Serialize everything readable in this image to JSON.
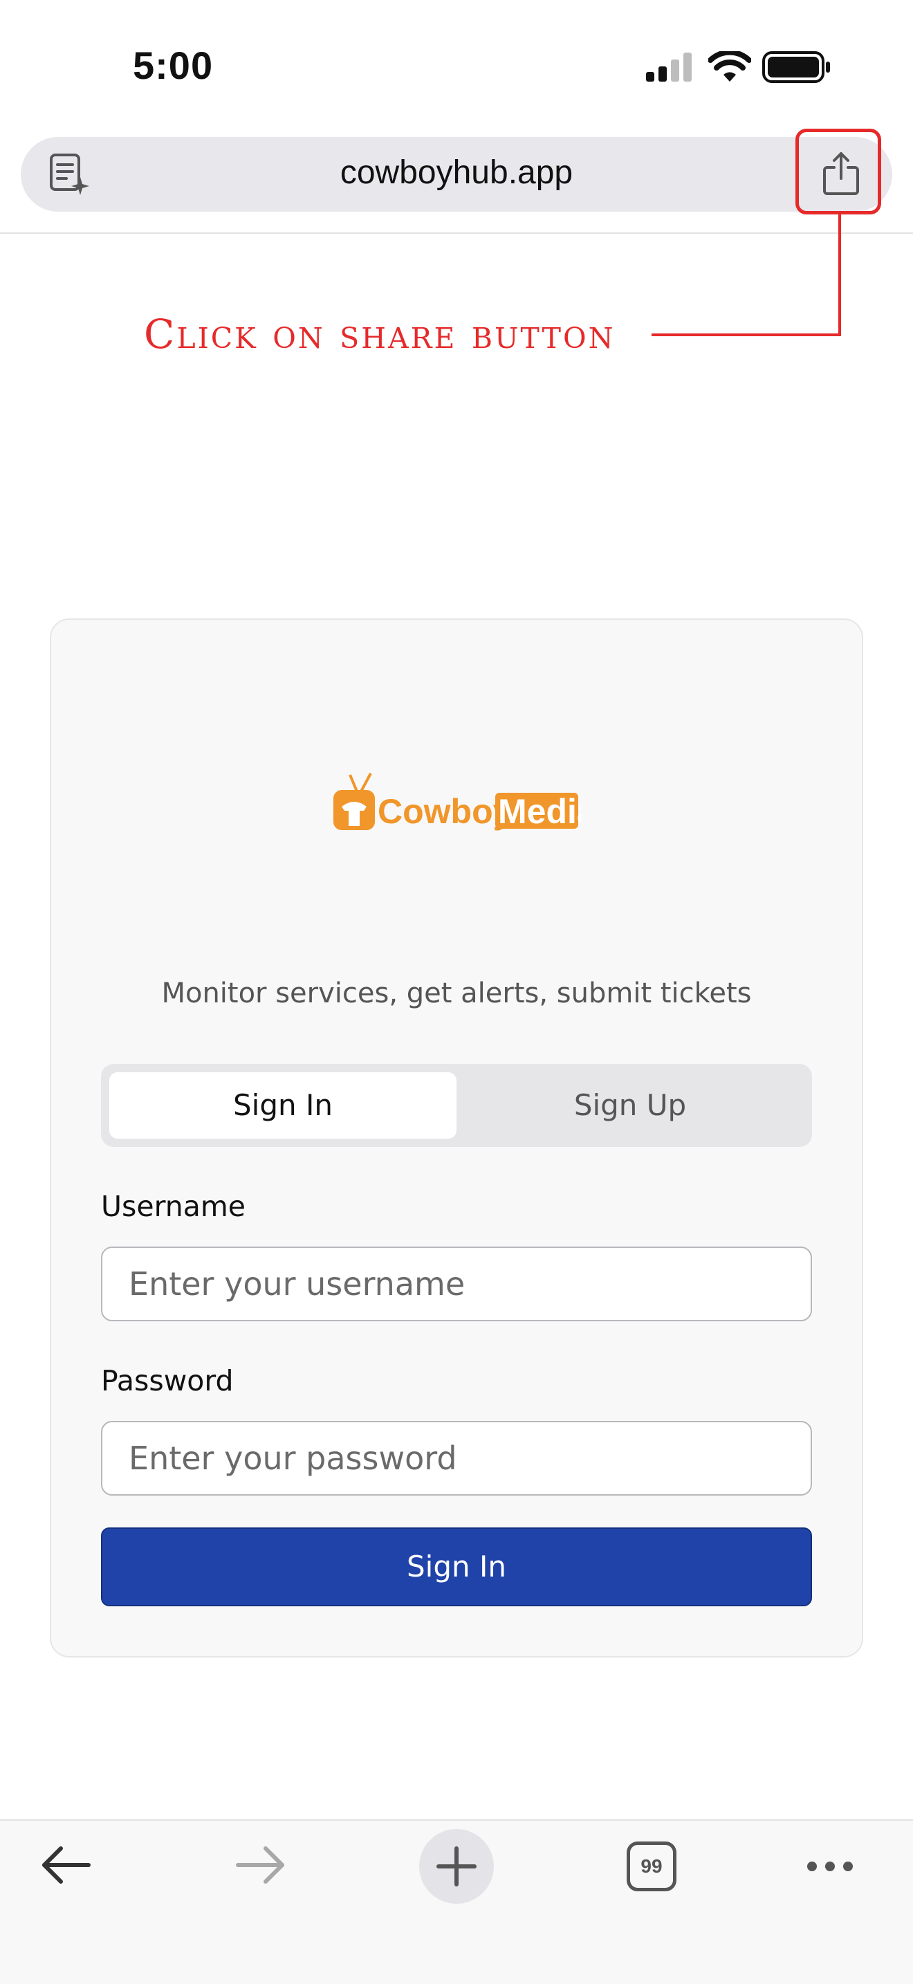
{
  "status_bar": {
    "time": "5:00"
  },
  "browser": {
    "url": "cowboyhub.app",
    "tabs_count": "99"
  },
  "annotation": {
    "text": "Click on share button",
    "color": "#e62a2a"
  },
  "login": {
    "logo_text_primary": "Cowboy",
    "logo_text_secondary": "Media",
    "tagline": "Monitor services, get alerts, submit tickets",
    "tabs": [
      {
        "label": "Sign In",
        "active": true
      },
      {
        "label": "Sign Up",
        "active": false
      }
    ],
    "username": {
      "label": "Username",
      "placeholder": "Enter your username",
      "value": ""
    },
    "password": {
      "label": "Password",
      "placeholder": "Enter your password",
      "value": ""
    },
    "submit_label": "Sign In",
    "accent_color": "#1f43a8",
    "logo_color": "#f0962a"
  },
  "icons": {
    "reader": "reader-mode-icon",
    "share": "share-icon",
    "back": "back-arrow-icon",
    "forward": "forward-arrow-icon",
    "new_tab": "plus-icon",
    "more": "ellipsis-icon"
  }
}
